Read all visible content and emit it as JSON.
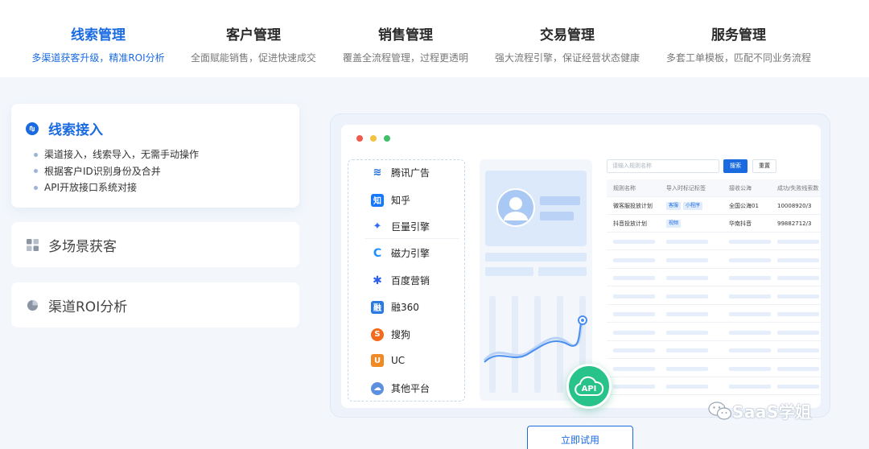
{
  "top_tabs": [
    {
      "title": "线索管理",
      "subtitle": "多渠道获客升级，精准ROI分析",
      "active": true
    },
    {
      "title": "客户管理",
      "subtitle": "全面赋能销售，促进快速成交",
      "active": false
    },
    {
      "title": "销售管理",
      "subtitle": "覆盖全流程管理，过程更透明",
      "active": false
    },
    {
      "title": "交易管理",
      "subtitle": "强大流程引擎，保证经营状态健康",
      "active": false
    },
    {
      "title": "服务管理",
      "subtitle": "多套工单模板，匹配不同业务流程",
      "active": false
    }
  ],
  "feature_cards": [
    {
      "title": "线索接入",
      "icon": "link-circle-icon",
      "expanded": true,
      "bullets": [
        "渠道接入，线索导入，无需手动操作",
        "根据客户ID识别身份及合并",
        "API开放接口系统对接"
      ]
    },
    {
      "title": "多场景获客",
      "icon": "grid-icon",
      "expanded": false
    },
    {
      "title": "渠道ROI分析",
      "icon": "pie-chart-icon",
      "expanded": false
    }
  ],
  "mockup": {
    "window_lights": [
      "#f05a4a",
      "#f5c342",
      "#3fbf6a"
    ],
    "platforms": [
      {
        "label": "腾讯广告",
        "icon": "tencent-ads-icon",
        "color": "#1b6be0",
        "glyph": "≋"
      },
      {
        "label": "知乎",
        "icon": "zhihu-icon",
        "color": "#1677ff",
        "glyph": "知"
      },
      {
        "label": "巨量引擎",
        "icon": "ocean-engine-icon",
        "color": "#2d6cf5",
        "glyph": "✦"
      },
      {
        "label": "磁力引擎",
        "icon": "magnetic-engine-icon",
        "color": "#1e90ff",
        "glyph": "C"
      },
      {
        "label": "百度营销",
        "icon": "baidu-icon",
        "color": "#2e5fe8",
        "glyph": "✱"
      },
      {
        "label": "融360",
        "icon": "rong360-icon",
        "color": "#2a7ae2",
        "glyph": "融"
      },
      {
        "label": "搜狗",
        "icon": "sogou-icon",
        "color": "#f26a1b",
        "glyph": "S"
      },
      {
        "label": "UC",
        "icon": "uc-icon",
        "color": "#f08a24",
        "glyph": "U"
      },
      {
        "label": "其他平台",
        "icon": "cloud-icon",
        "color": "#5b8fe0",
        "glyph": "☁"
      }
    ],
    "search_placeholder": "请输入规则名称",
    "search_button": "搜索",
    "reset_button": "重置",
    "table": {
      "headers": [
        "规则名称",
        "导入时标记标签",
        "接收公海",
        "成功/失败线索数"
      ],
      "rows": [
        {
          "name": "微客服投放计划",
          "tags": [
            "客服",
            "小程序"
          ],
          "pool": "全国公海01",
          "count": "10008920/3"
        },
        {
          "name": "抖音投放计划",
          "tags": [
            "视频"
          ],
          "pool": "华南抖音",
          "count": "99882712/3"
        }
      ]
    },
    "api_badge": "API"
  },
  "cta_button": "立即试用",
  "watermark": "SaaS学姐",
  "colors": {
    "brand_blue": "#1b6be0",
    "api_green": "#28c28b"
  }
}
